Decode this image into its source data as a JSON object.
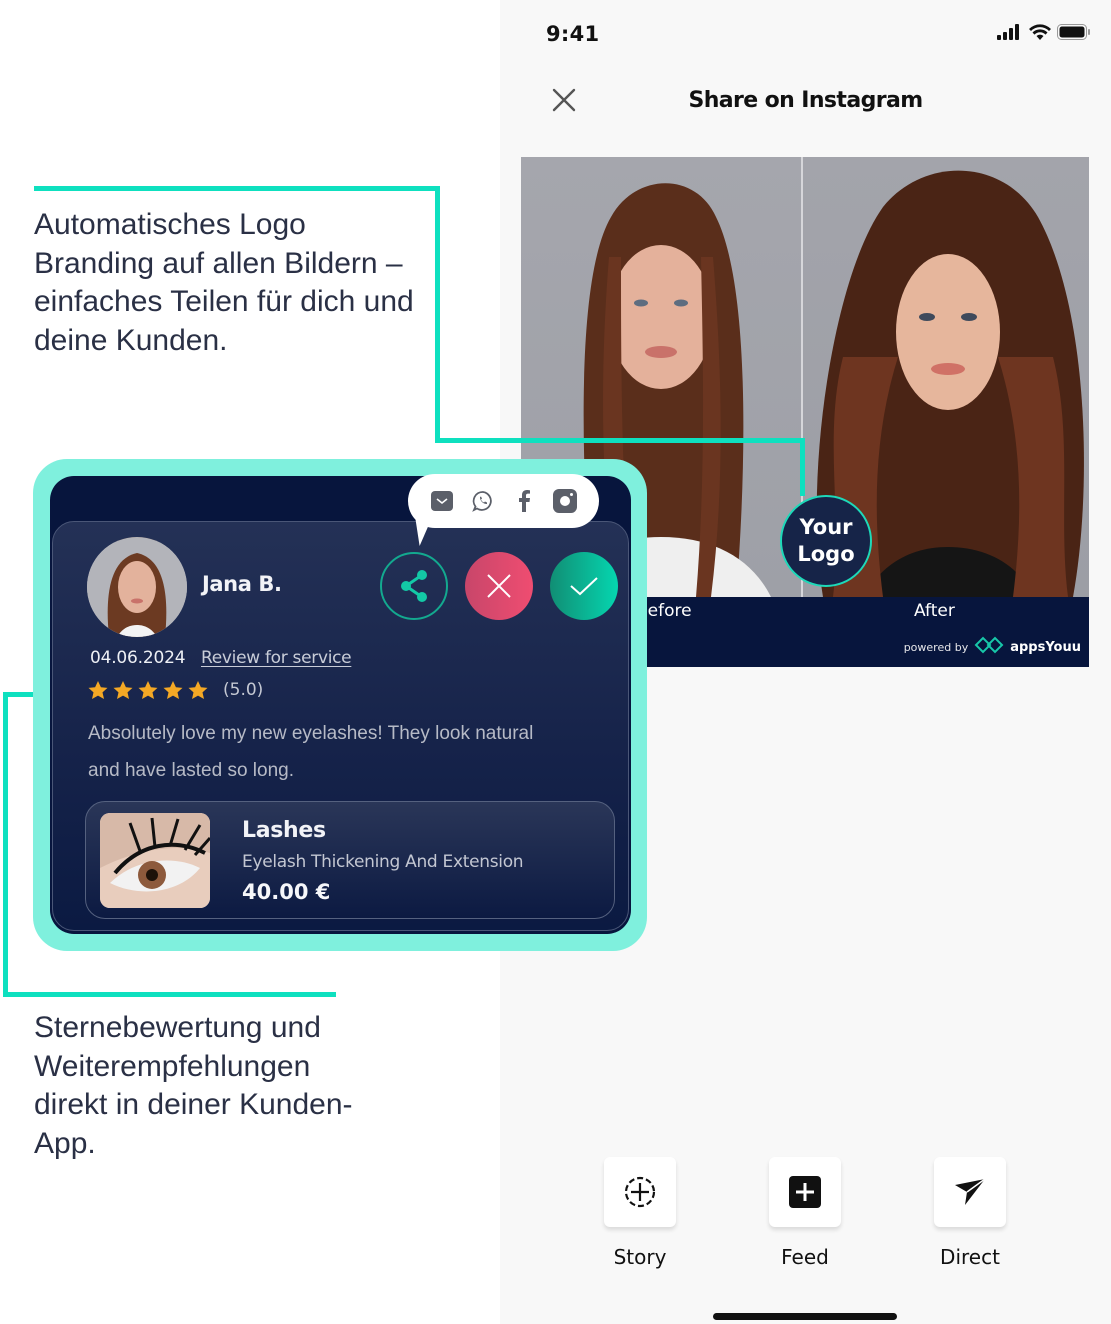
{
  "annotations": {
    "top": "Automatisches Logo Branding auf allen Bildern – einfaches Teilen für dich und deine Kunden.",
    "bottom": "Sternebewertung und Weiterempfehlungen direkt in deiner Kunden-App."
  },
  "status_bar": {
    "time": "9:41",
    "icons": [
      "signal-icon",
      "wifi-icon",
      "battery-icon"
    ]
  },
  "nav": {
    "title": "Share on Instagram",
    "close_icon": "close-icon"
  },
  "preview": {
    "before_label": "Before",
    "after_label": "After",
    "logo_line1": "Your",
    "logo_line2": "Logo",
    "powered_by": "powered by",
    "brand": "appsYouu"
  },
  "share_options": [
    {
      "label": "Story",
      "icon": "story-add-icon"
    },
    {
      "label": "Feed",
      "icon": "feed-add-icon"
    },
    {
      "label": "Direct",
      "icon": "send-icon"
    }
  ],
  "review": {
    "reviewer": "Jana B.",
    "date": "04.06.2024",
    "link": "Review for service",
    "rating": 5,
    "rating_text": "(5.0)",
    "text": "Absolutely love my new eyelashes! They look natural and have lasted so long.",
    "share_targets": [
      "email-icon",
      "whatsapp-icon",
      "facebook-icon",
      "instagram-icon"
    ],
    "actions": [
      "share-icon",
      "reject-icon",
      "accept-icon"
    ],
    "product": {
      "name": "Lashes",
      "description": "Eyelash Thickening And Extension",
      "price": "40.00 €"
    }
  },
  "colors": {
    "accent": "#0ee0bf",
    "card_frame": "#7ff0dd",
    "navy": "#07153d",
    "reject": "#ef4d71",
    "accept": "#05d6b0",
    "star": "#f4a825"
  }
}
